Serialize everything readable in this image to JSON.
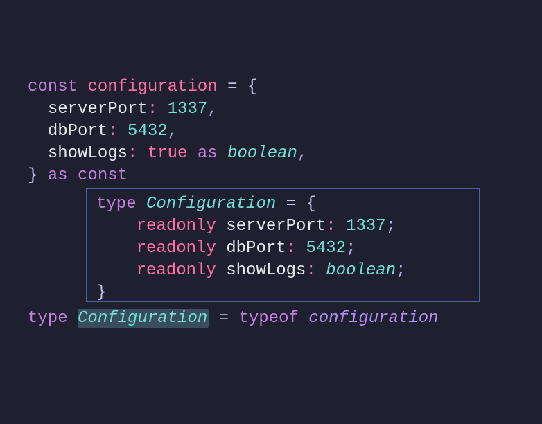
{
  "code": {
    "kw_const": "const",
    "var_configuration": "configuration",
    "eq": "=",
    "brace_open": "{",
    "brace_close": "}",
    "prop_serverPort": "serverPort",
    "prop_dbPort": "dbPort",
    "prop_showLogs": "showLogs",
    "colon": ":",
    "num_1337": "1337",
    "num_5432": "5432",
    "bool_true": "true",
    "kw_as": "as",
    "type_boolean": "boolean",
    "comma": ",",
    "kw_type": "type",
    "type_Configuration": "Configuration",
    "kw_readonly": "readonly",
    "semi": ";",
    "kw_typeof": "typeof"
  }
}
